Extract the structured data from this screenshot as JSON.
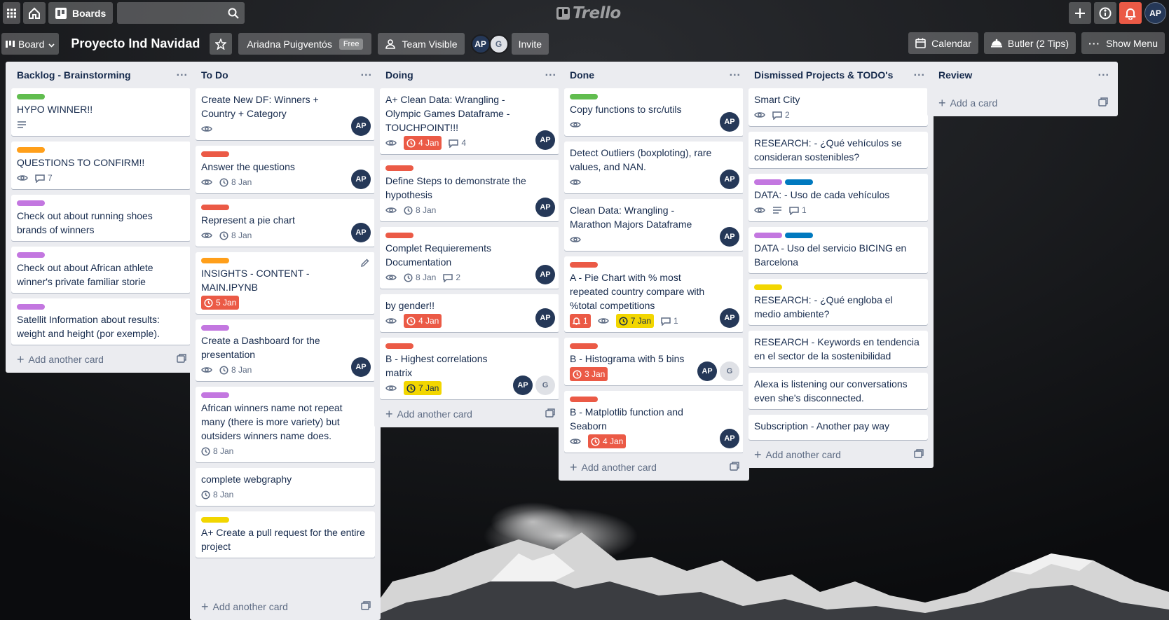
{
  "topnav": {
    "boards_label": "Boards",
    "search_value": "",
    "logo_text": "Trello",
    "user_initials": "AP"
  },
  "header": {
    "board_view_label": "Board",
    "board_title": "Proyecto Ind Navidad",
    "workspace_label": "Ariadna Puigventós",
    "workspace_badge": "Free",
    "visibility_label": "Team Visible",
    "members": [
      {
        "initials": "AP"
      },
      {
        "initials": "G"
      }
    ],
    "invite_label": "Invite",
    "calendar_label": "Calendar",
    "butler_label": "Butler (2 Tips)",
    "show_menu_label": "Show Menu"
  },
  "colors": {
    "green": "#61bd4f",
    "orange": "#ff9f1a",
    "purple": "#c377e0",
    "red": "#eb5a46",
    "blue": "#0079bf",
    "yellow": "#f2d600",
    "avatar": "#253858"
  },
  "lists": [
    {
      "title": "Backlog - Brainstorming",
      "add_label": "Add another card",
      "cards": [
        {
          "title": "HYPO WINNER!!",
          "labels": [
            "#61bd4f"
          ],
          "badges": {
            "description": true
          }
        },
        {
          "title": "QUESTIONS TO CONFIRM!!",
          "labels": [
            "#ff9f1a"
          ],
          "badges": {
            "watch": true,
            "comments": "7"
          }
        },
        {
          "title": "Check out about running shoes brands of winners",
          "labels": [
            "#c377e0"
          ]
        },
        {
          "title": "Check out about African athlete winner's private familiar storie",
          "labels": [
            "#c377e0"
          ]
        },
        {
          "title": "Satellit Information about results: weight and height (por exemple).",
          "labels": [
            "#c377e0"
          ]
        }
      ]
    },
    {
      "title": "To Do",
      "add_label": "Add another card",
      "cards": [
        {
          "title": "Create New DF: Winners + Country + Category",
          "labels": [],
          "badges": {
            "watch": true
          },
          "members": [
            "AP"
          ]
        },
        {
          "title": "Answer the questions",
          "labels": [
            "#eb5a46"
          ],
          "badges": {
            "watch": true,
            "date": "8 Jan"
          },
          "members": [
            "AP"
          ]
        },
        {
          "title": "Represent a pie chart",
          "labels": [
            "#eb5a46"
          ],
          "badges": {
            "watch": true,
            "date": "8 Jan"
          },
          "members": [
            "AP"
          ]
        },
        {
          "title": "INSIGHTS - CONTENT - MAIN.IPYNB",
          "labels": [
            "#ff9f1a"
          ],
          "badges": {
            "due_red": "5 Jan"
          },
          "edit": true
        },
        {
          "title": "Create a Dashboard for the presentation",
          "labels": [
            "#c377e0"
          ],
          "badges": {
            "watch": true,
            "date": "8 Jan"
          },
          "members": [
            "AP"
          ]
        },
        {
          "title": "African winners name not repeat many (there is more variety) but outsiders winners name does.",
          "labels": [
            "#c377e0"
          ],
          "badges": {
            "date": "8 Jan"
          }
        },
        {
          "title": "complete webgraphy",
          "labels": [],
          "badges": {
            "date": "8 Jan"
          }
        },
        {
          "title": "A+ Create a pull request for the entire project",
          "labels": [
            "#f2d600"
          ]
        }
      ]
    },
    {
      "title": "Doing",
      "add_label": "Add another card",
      "cards": [
        {
          "title": "A+ Clean Data: Wrangling - Olympic Games Dataframe - TOUCHPOINT!!!",
          "labels": [],
          "badges": {
            "watch": true,
            "due_red": "4 Jan",
            "comments": "4"
          },
          "members": [
            "AP"
          ]
        },
        {
          "title": "Define Steps to demonstrate the hypothesis",
          "labels": [
            "#eb5a46"
          ],
          "badges": {
            "watch": true,
            "date": "8 Jan"
          },
          "members": [
            "AP"
          ]
        },
        {
          "title": "Complet Requierements Documentation",
          "labels": [
            "#eb5a46"
          ],
          "badges": {
            "watch": true,
            "date": "8 Jan",
            "comments": "2"
          },
          "members": [
            "AP"
          ]
        },
        {
          "title": "by gender!!",
          "labels": [],
          "badges": {
            "watch": true,
            "due_red": "4 Jan"
          },
          "members": [
            "AP"
          ]
        },
        {
          "title": "B - Highest correlations matrix",
          "labels": [
            "#eb5a46"
          ],
          "badges": {
            "watch": true,
            "due_yellow": "7 Jan"
          },
          "members": [
            "AP",
            "G"
          ]
        }
      ]
    },
    {
      "title": "Done",
      "add_label": "Add another card",
      "cards": [
        {
          "title": "Copy functions to src/utils",
          "labels": [
            "#61bd4f"
          ],
          "badges": {
            "watch": true
          },
          "members": [
            "AP"
          ]
        },
        {
          "title": "Detect Outliers (boxploting), rare values, and NAN.",
          "labels": [],
          "badges": {
            "watch": true
          },
          "members": [
            "AP"
          ]
        },
        {
          "title": "Clean Data: Wrangling - Marathon Majors Dataframe",
          "labels": [],
          "badges": {
            "watch": true
          },
          "members": [
            "AP"
          ]
        },
        {
          "title": "A - Pie Chart with % most repeated country compare with %total competitions",
          "labels": [
            "#eb5a46"
          ],
          "badges": {
            "notif": "1",
            "watch": true,
            "due_yellow": "7 Jan",
            "comments": "1"
          },
          "members": [
            "AP"
          ]
        },
        {
          "title": "B - Histograma with 5 bins",
          "labels": [
            "#eb5a46"
          ],
          "badges": {
            "due_red": "3 Jan"
          },
          "members": [
            "AP",
            "G"
          ]
        },
        {
          "title": "B - Matplotlib function and Seaborn",
          "labels": [
            "#eb5a46"
          ],
          "badges": {
            "watch": true,
            "due_red": "4 Jan"
          },
          "members": [
            "AP"
          ]
        }
      ]
    },
    {
      "title": "Dismissed Projects & TODO's",
      "add_label": "Add another card",
      "cards": [
        {
          "title": "Smart City",
          "labels": [],
          "badges": {
            "watch": true,
            "comments": "2"
          }
        },
        {
          "title": "RESEARCH: - ¿Qué vehículos se consideran sostenibles?",
          "labels": []
        },
        {
          "title": "DATA: - Uso de cada vehículos",
          "labels": [
            "#c377e0",
            "#0079bf"
          ],
          "badges": {
            "watch": true,
            "description": true,
            "comments": "1"
          }
        },
        {
          "title": "DATA - Uso del servicio BICING en Barcelona",
          "labels": [
            "#c377e0",
            "#0079bf"
          ]
        },
        {
          "title": "RESEARCH: - ¿Qué engloba el medio ambiente?",
          "labels": [
            "#f2d600"
          ]
        },
        {
          "title": "RESEARCH - Keywords en tendencia en el sector de la sostenibilidad",
          "labels": []
        },
        {
          "title": "Alexa is listening our conversations even she's disconnected.",
          "labels": []
        },
        {
          "title": "Subscription - Another pay way",
          "labels": []
        }
      ]
    },
    {
      "title": "Review",
      "add_label": "Add a card",
      "cards": []
    }
  ]
}
